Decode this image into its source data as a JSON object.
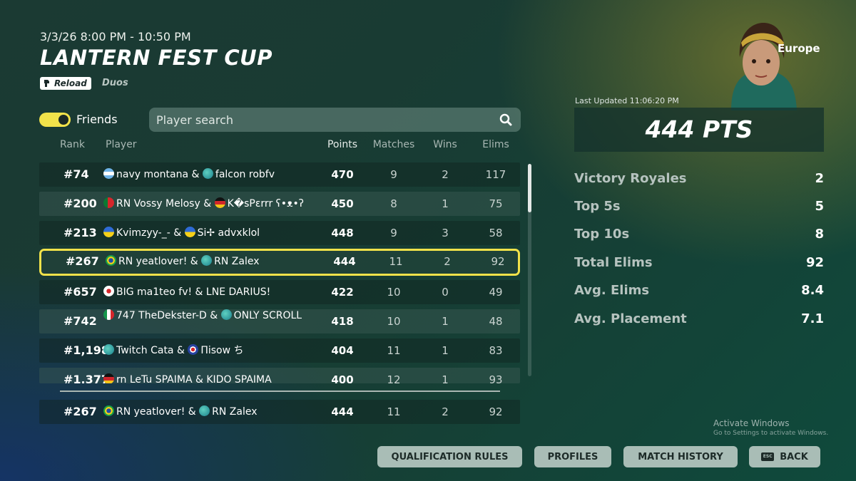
{
  "event": {
    "date": "3/3/26 8:00 PM - 10:50 PM",
    "title": "LANTERN FEST CUP",
    "mode_badge": "Reload",
    "team_mode": "Duos"
  },
  "filters": {
    "friends_label": "Friends",
    "friends_on": true,
    "search_placeholder": "Player search"
  },
  "table": {
    "headers": {
      "rank": "Rank",
      "player": "Player",
      "points": "Points",
      "matches": "Matches",
      "wins": "Wins",
      "elims": "Elims"
    },
    "rows": [
      {
        "rank": "#74",
        "player": "navy montana & ",
        "player2": "falcon robfv",
        "points": "470",
        "matches": "9",
        "wins": "2",
        "elims": "117"
      },
      {
        "rank": "#200",
        "player": "RN Vossy Melosy & ",
        "player2": "K�sPɛrrr ʕ•ᴥ•ʔ",
        "points": "450",
        "matches": "8",
        "wins": "1",
        "elims": "75"
      },
      {
        "rank": "#213",
        "player": "Kvimzyy-_- & ",
        "player2": "Si✢ advxklol",
        "points": "448",
        "matches": "9",
        "wins": "3",
        "elims": "58"
      },
      {
        "rank": "#267",
        "player": "RN yeatlover! & ",
        "player2": "RN Zalex",
        "points": "444",
        "matches": "11",
        "wins": "2",
        "elims": "92"
      },
      {
        "rank": "#657",
        "player": "BIG ma1teo fv! & LNE DARIUS!",
        "player2": "",
        "points": "422",
        "matches": "10",
        "wins": "0",
        "elims": "49"
      },
      {
        "rank": "#742",
        "player": "747 TheDekster-D & ",
        "player2": "ONLY SCROLL",
        "points": "418",
        "matches": "10",
        "wins": "1",
        "elims": "48"
      },
      {
        "rank": "#1,198",
        "player": "Twitch Cata & ",
        "player2": "Πisow ち",
        "points": "404",
        "matches": "11",
        "wins": "1",
        "elims": "83"
      },
      {
        "rank": "#1,377",
        "player": "rn LeTu SPAIMA & KIDO SPAIMA",
        "player2": "",
        "points": "400",
        "matches": "12",
        "wins": "1",
        "elims": "93"
      }
    ],
    "pinned": {
      "rank": "#267",
      "player": "RN yeatlover! & ",
      "player2": "RN Zalex",
      "points": "444",
      "matches": "11",
      "wins": "2",
      "elims": "92"
    }
  },
  "summary": {
    "region": "Europe",
    "last_updated": "Last Updated 11:06:20 PM",
    "points": "444 PTS",
    "stats": [
      {
        "label": "Victory Royales",
        "value": "2"
      },
      {
        "label": "Top 5s",
        "value": "5"
      },
      {
        "label": "Top 10s",
        "value": "8"
      },
      {
        "label": "Total Elims",
        "value": "92"
      },
      {
        "label": "Avg. Elims",
        "value": "8.4"
      },
      {
        "label": "Avg. Placement",
        "value": "7.1"
      }
    ]
  },
  "watermark": {
    "title": "Activate Windows",
    "subtitle": "Go to Settings to activate Windows."
  },
  "buttons": {
    "qualification": "QUALIFICATION RULES",
    "profiles": "PROFILES",
    "match_history": "MATCH HISTORY",
    "back": "BACK",
    "back_key": "ESC"
  },
  "colors": {
    "highlight": "#f1e24a",
    "button_bg": "#a9bdb6"
  },
  "icons": {
    "search": "search-icon",
    "mode": "reload-icon",
    "back_key": "esc-key-icon"
  }
}
